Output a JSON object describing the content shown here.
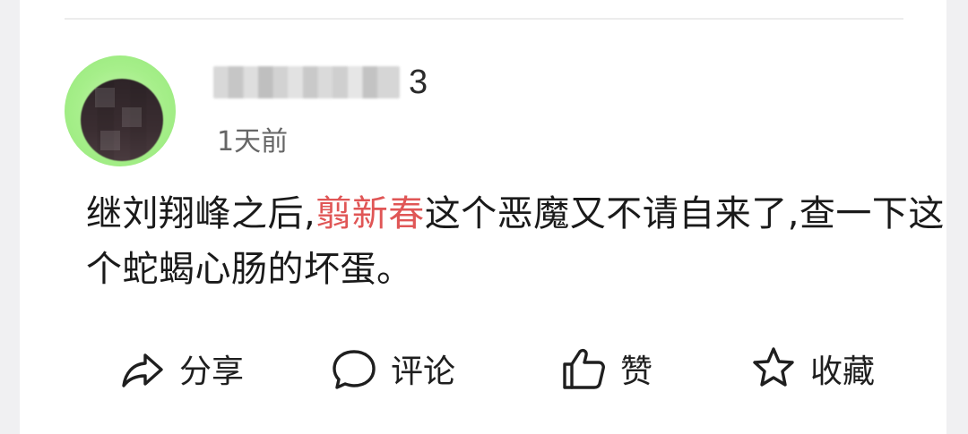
{
  "post": {
    "username_visible_suffix": "3",
    "time_ago": "1天前",
    "content": {
      "before": "继刘翔峰之后,",
      "highlight": "翦新春",
      "after": "这个恶魔又不请自来了,查一下这个蛇蝎心肠的坏蛋。"
    },
    "actions": {
      "share_label": "分享",
      "comment_label": "评论",
      "like_label": "赞",
      "collect_label": "收藏"
    }
  },
  "colors": {
    "highlight": "#e05656",
    "text": "#1a1a1a",
    "secondary": "#666666",
    "avatar_ring": "#a6ef8a"
  },
  "icons": {
    "share": "share-arrow-icon",
    "comment": "speech-bubble-icon",
    "like": "thumbs-up-icon",
    "collect": "star-icon"
  }
}
